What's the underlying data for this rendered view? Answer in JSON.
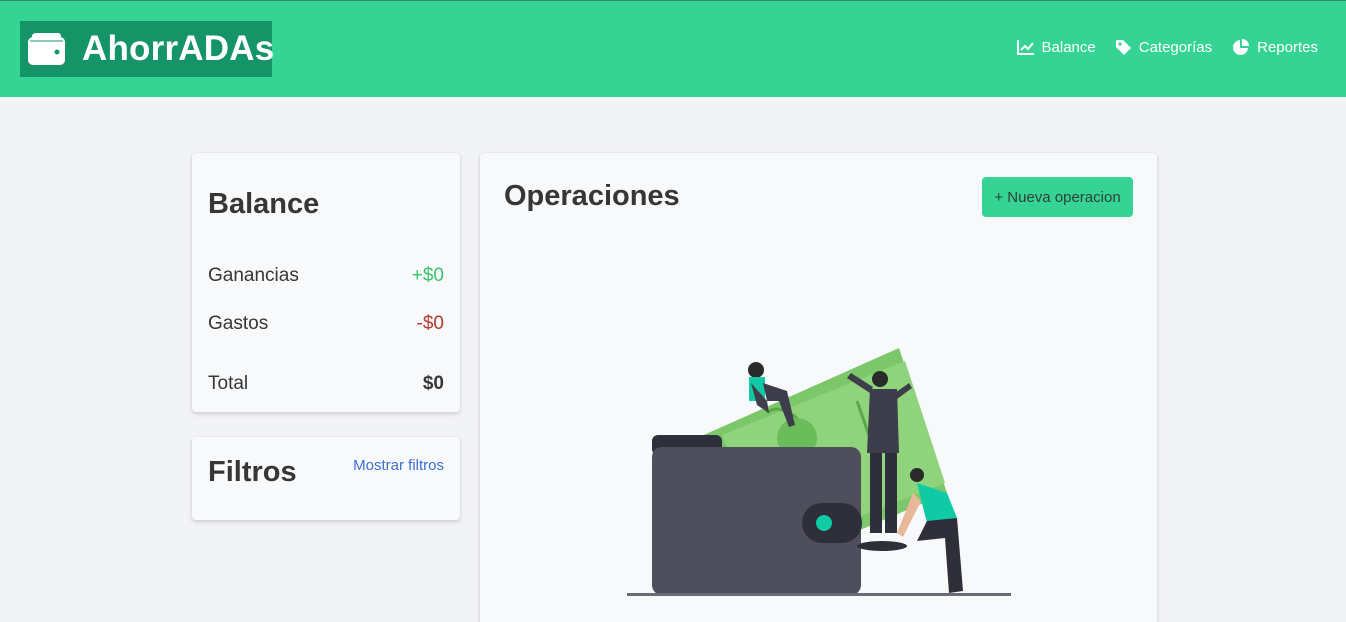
{
  "app": {
    "title": "AhorrADAs"
  },
  "nav": {
    "items": [
      {
        "label": "Balance",
        "icon": "chart-line-icon"
      },
      {
        "label": "Categorías",
        "icon": "tag-icon"
      },
      {
        "label": "Reportes",
        "icon": "pie-chart-icon"
      }
    ]
  },
  "balance": {
    "title": "Balance",
    "rows": [
      {
        "label": "Ganancias",
        "value": "+$0"
      },
      {
        "label": "Gastos",
        "value": "-$0"
      },
      {
        "label": "Total",
        "value": "$0"
      }
    ]
  },
  "filters": {
    "title": "Filtros",
    "toggle_label": "Mostrar filtros"
  },
  "operations": {
    "title": "Operaciones",
    "new_button_label": "+ Nueva operacion"
  },
  "colors": {
    "navbar": "#36d494",
    "brand_bg": "#159467",
    "positive": "#3bc569",
    "negative": "#b53a2f",
    "link": "#3c6ed4"
  }
}
